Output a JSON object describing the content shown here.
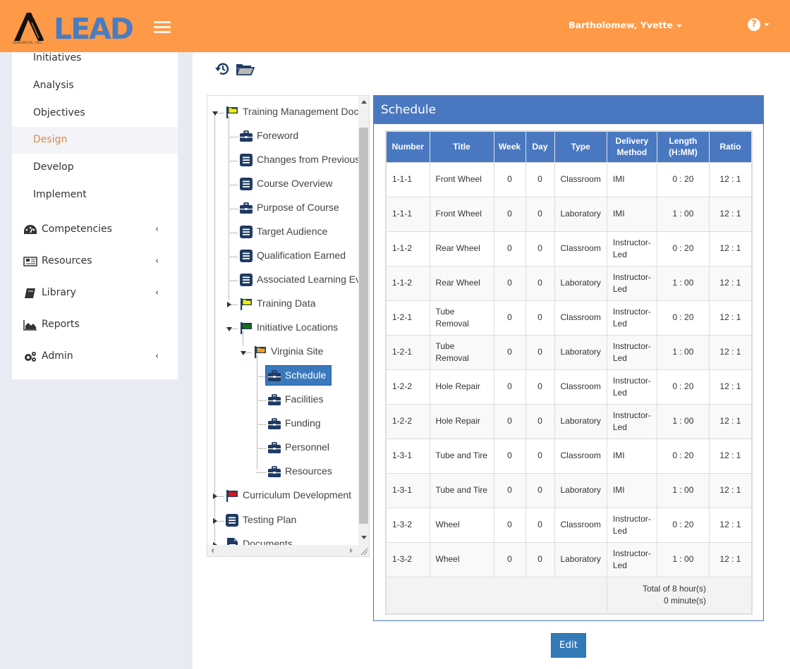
{
  "app": {
    "logo_text": "LEAD",
    "company": "AIMEREON, INC.",
    "brand_color": "#fe9947",
    "accent_color": "#4a78c0"
  },
  "header": {
    "user_name": "Bartholomew, Yvette",
    "help_icon": "question-circle-icon"
  },
  "sidebar": {
    "sub_items": [
      {
        "label": "Initiatives"
      },
      {
        "label": "Analysis"
      },
      {
        "label": "Objectives"
      },
      {
        "label": "Design",
        "active": true
      },
      {
        "label": "Develop"
      },
      {
        "label": "Implement"
      }
    ],
    "groups": [
      {
        "label": "Competencies",
        "icon": "dashboard-icon",
        "expandable": true
      },
      {
        "label": "Resources",
        "icon": "newspaper-icon",
        "expandable": true
      },
      {
        "label": "Library",
        "icon": "book-icon",
        "expandable": true
      },
      {
        "label": "Reports",
        "icon": "area-chart-icon",
        "expandable": false
      },
      {
        "label": "Admin",
        "icon": "gears-icon",
        "expandable": true
      }
    ],
    "chevron": "‹"
  },
  "toolbar": {
    "history_icon": "history-icon",
    "open_folder_icon": "folder-open-icon"
  },
  "tree": {
    "nodes": [
      {
        "label": "Training Management Doc",
        "icon": "flag-yellow",
        "state": "open"
      },
      {
        "label": "Foreword",
        "icon": "briefcase"
      },
      {
        "label": "Changes from Previous",
        "icon": "list-doc"
      },
      {
        "label": "Course Overview",
        "icon": "list-doc"
      },
      {
        "label": "Purpose of Course",
        "icon": "briefcase"
      },
      {
        "label": "Target Audience",
        "icon": "list-doc"
      },
      {
        "label": "Qualification Earned",
        "icon": "list-doc"
      },
      {
        "label": "Associated Learning Ev",
        "icon": "list-doc"
      },
      {
        "label": "Training Data",
        "icon": "flag-yellow",
        "state": "closed"
      },
      {
        "label": "Initiative Locations",
        "icon": "flag-green",
        "state": "open"
      },
      {
        "label": "Virginia Site",
        "icon": "flag-orange",
        "state": "open"
      },
      {
        "label": "Schedule",
        "icon": "briefcase",
        "selected": true
      },
      {
        "label": "Facilities",
        "icon": "briefcase"
      },
      {
        "label": "Funding",
        "icon": "briefcase"
      },
      {
        "label": "Personnel",
        "icon": "briefcase"
      },
      {
        "label": "Resources",
        "icon": "briefcase"
      },
      {
        "label": "Curriculum Development",
        "icon": "flag-red",
        "state": "closed"
      },
      {
        "label": "Testing Plan",
        "icon": "list-doc",
        "state": "closed"
      },
      {
        "label": "Documents",
        "icon": "file-doc",
        "state": "closed"
      }
    ]
  },
  "schedule": {
    "title": "Schedule",
    "columns": [
      "Number",
      "Title",
      "Week",
      "Day",
      "Type",
      "Delivery Method",
      "Length (H:MM)",
      "Ratio"
    ],
    "rows": [
      {
        "number": "1-1-1",
        "title": "Front Wheel",
        "week": "0",
        "day": "0",
        "type": "Classroom",
        "delivery": "IMI",
        "length": "0 : 20",
        "ratio": "12 : 1"
      },
      {
        "number": "1-1-1",
        "title": "Front Wheel",
        "week": "0",
        "day": "0",
        "type": "Laboratory",
        "delivery": "IMI",
        "length": "1 : 00",
        "ratio": "12 : 1"
      },
      {
        "number": "1-1-2",
        "title": "Rear Wheel",
        "week": "0",
        "day": "0",
        "type": "Classroom",
        "delivery": "Instructor-Led",
        "length": "0 : 20",
        "ratio": "12 : 1"
      },
      {
        "number": "1-1-2",
        "title": "Rear Wheel",
        "week": "0",
        "day": "0",
        "type": "Laboratory",
        "delivery": "Instructor-Led",
        "length": "1 : 00",
        "ratio": "12 : 1"
      },
      {
        "number": "1-2-1",
        "title": "Tube Removal",
        "week": "0",
        "day": "0",
        "type": "Classroom",
        "delivery": "Instructor-Led",
        "length": "0 : 20",
        "ratio": "12 : 1"
      },
      {
        "number": "1-2-1",
        "title": "Tube Removal",
        "week": "0",
        "day": "0",
        "type": "Laboratory",
        "delivery": "Instructor-Led",
        "length": "1 : 00",
        "ratio": "12 : 1"
      },
      {
        "number": "1-2-2",
        "title": "Hole Repair",
        "week": "0",
        "day": "0",
        "type": "Classroom",
        "delivery": "Instructor-Led",
        "length": "0 : 20",
        "ratio": "12 : 1"
      },
      {
        "number": "1-2-2",
        "title": "Hole Repair",
        "week": "0",
        "day": "0",
        "type": "Laboratory",
        "delivery": "Instructor-Led",
        "length": "1 : 00",
        "ratio": "12 : 1"
      },
      {
        "number": "1-3-1",
        "title": "Tube and Tire",
        "week": "0",
        "day": "0",
        "type": "Classroom",
        "delivery": "IMI",
        "length": "0 : 20",
        "ratio": "12 : 1"
      },
      {
        "number": "1-3-1",
        "title": "Tube and Tire",
        "week": "0",
        "day": "0",
        "type": "Laboratory",
        "delivery": "IMI",
        "length": "1 : 00",
        "ratio": "12 : 1"
      },
      {
        "number": "1-3-2",
        "title": "Wheel",
        "week": "0",
        "day": "0",
        "type": "Classroom",
        "delivery": "Instructor-Led",
        "length": "0 : 20",
        "ratio": "12 : 1"
      },
      {
        "number": "1-3-2",
        "title": "Wheel",
        "week": "0",
        "day": "0",
        "type": "Laboratory",
        "delivery": "Instructor-Led",
        "length": "1 : 00",
        "ratio": "12 : 1"
      }
    ],
    "total_hours": "Total of 8 hour(s)",
    "total_minutes": "0 minute(s)"
  },
  "actions": {
    "edit_label": "Edit"
  }
}
